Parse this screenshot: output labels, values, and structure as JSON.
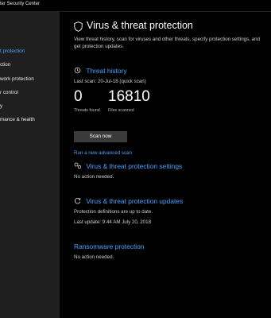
{
  "window": {
    "title": "ter Security Center"
  },
  "sidebar": {
    "items": [
      {
        "label": "t protection",
        "active": true
      },
      {
        "label": "ction"
      },
      {
        "label": "work protection"
      },
      {
        "label": "r control"
      },
      {
        "label": "y"
      },
      {
        "label": "mance & health"
      }
    ]
  },
  "page": {
    "title": "Virus & threat protection",
    "title_icon": "shield-icon",
    "description": "View threat history, scan for viruses and other threats, specify protection settings, and get protection updates."
  },
  "threat_history": {
    "heading": "Threat history",
    "icon": "history-icon",
    "last_scan": "Last scan: 20-Jul-18 (quick scan)",
    "threats_found_value": "0",
    "threats_found_label": "Threats found",
    "files_scanned_value": "16810",
    "files_scanned_label": "Files scanned",
    "scan_button": "Scan now",
    "advanced_link": "Run a new advanced scan"
  },
  "settings": {
    "heading": "Virus & threat protection settings",
    "icon": "gears-icon",
    "status": "No action needed."
  },
  "updates": {
    "heading": "Virus & threat protection updates",
    "icon": "refresh-icon",
    "status": "Protection definitions are up to date.",
    "last_update": "Last update: 9:44 AM July 20, 2018"
  },
  "ransomware": {
    "heading": "Ransomware protection",
    "status": "No action needed."
  },
  "colors": {
    "accent": "#4aa3ff",
    "sidebar_bg": "#1f1f1f",
    "main_bg": "#000000",
    "button_bg": "#3a3a3a"
  }
}
